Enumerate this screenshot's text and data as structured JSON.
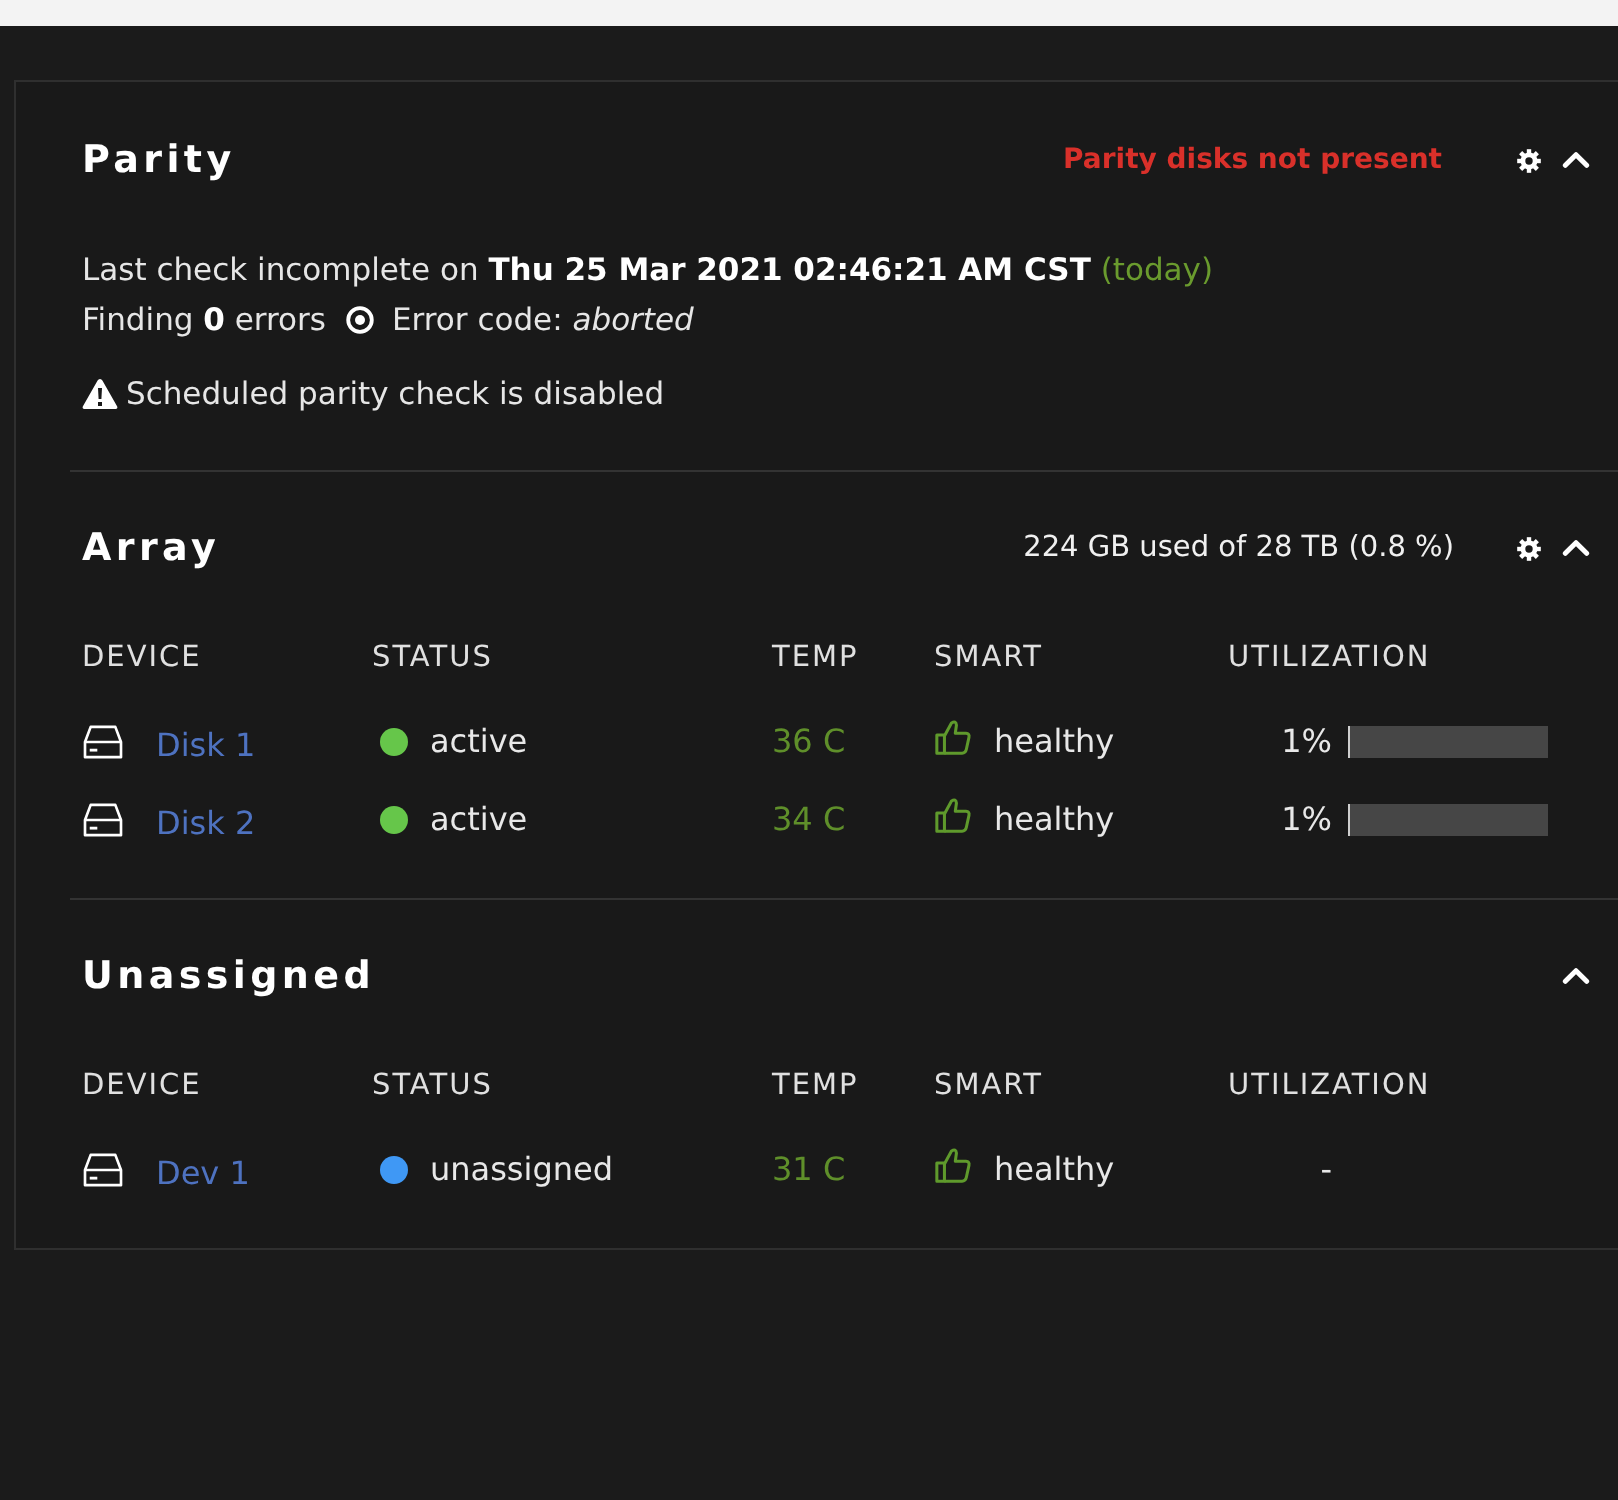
{
  "sections": [
    {
      "kind": "parity",
      "title": "Parity",
      "alert": "Parity disks not present",
      "settings": true,
      "expanded": true,
      "last_check": "Last check incomplete on **Thu 25 Mar 2021 02:46:21 AM CST**",
      "last_check_relative": "(today)",
      "findings": "Finding **0** errors",
      "error_code": "Error code: *aborted*",
      "warning": "Scheduled parity check is disabled"
    },
    {
      "kind": "devices",
      "title": "Array",
      "usage": "224 GB used of 28 TB (0.8 %)",
      "settings": true,
      "expanded": true,
      "columns": [
        "DEVICE",
        "STATUS",
        "TEMP",
        "SMART",
        "UTILIZATION"
      ],
      "rows": [
        {
          "device": "Disk 1",
          "status": "active",
          "color": "#66c64a",
          "temp": "36 C",
          "smart": "healthy",
          "utilization": "1%",
          "level": 0.01
        },
        {
          "device": "Disk 2",
          "status": "active",
          "color": "#66c64a",
          "temp": "34 C",
          "smart": "healthy",
          "utilization": "1%",
          "level": 0.01
        }
      ]
    },
    {
      "kind": "devices",
      "title": "Unassigned",
      "expanded": true,
      "columns": [
        "DEVICE",
        "STATUS",
        "TEMP",
        "SMART",
        "UTILIZATION"
      ],
      "rows": [
        {
          "device": "Dev 1",
          "status": "unassigned",
          "color": "#3f98f5",
          "temp": "31 C",
          "smart": "healthy",
          "utilization": "-"
        }
      ]
    }
  ]
}
